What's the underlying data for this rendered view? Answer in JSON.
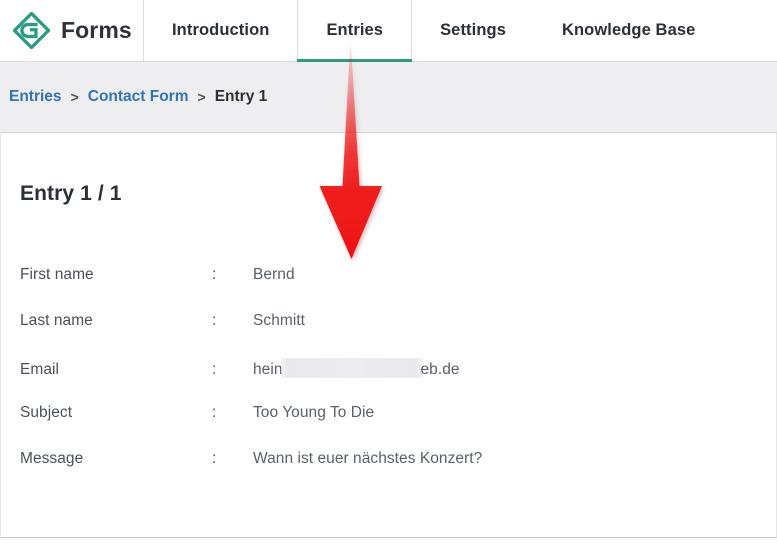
{
  "app": {
    "brand_name": "Forms",
    "logo_icon": "forms-diamond-logo-icon",
    "accent_color": "#2b9b84",
    "link_color": "#3174b4"
  },
  "nav": {
    "tabs": [
      {
        "label": "Introduction",
        "active": false
      },
      {
        "label": "Entries",
        "active": true
      },
      {
        "label": "Settings",
        "active": false
      },
      {
        "label": "Knowledge Base",
        "active": false
      }
    ]
  },
  "breadcrumb": {
    "separator": ">",
    "items": [
      {
        "label": "Entries",
        "is_link": true
      },
      {
        "label": "Contact Form",
        "is_link": true
      },
      {
        "label": "Entry 1",
        "is_link": false
      }
    ]
  },
  "main": {
    "title": "Entry 1 / 1",
    "colon": ":",
    "fields": [
      {
        "label": "First name",
        "value": "Bernd"
      },
      {
        "label": "Last name",
        "value": "Schmitt"
      },
      {
        "label": "Email",
        "value_prefix": "hein",
        "redacted": true,
        "value_suffix": "eb.de"
      },
      {
        "label": "Subject",
        "value": "Too Young To Die"
      },
      {
        "label": "Message",
        "value": "Wann ist euer nächstes Konzert?"
      }
    ]
  },
  "annotation": {
    "arrow_icon": "down-arrow-annotation-icon",
    "color": "#f01414",
    "points_at": "Entries"
  }
}
